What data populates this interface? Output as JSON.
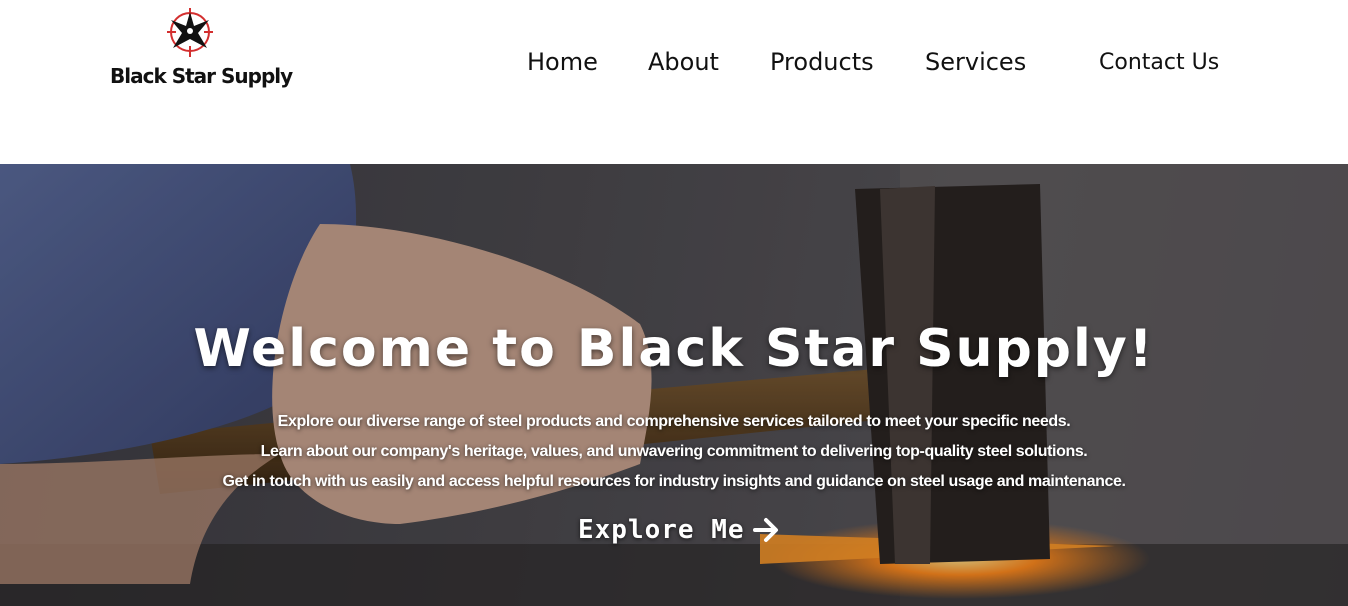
{
  "brand": {
    "name": "Black Star Supply",
    "logo_icon": "black-star-compass-icon"
  },
  "nav": {
    "items": [
      {
        "label": "Home"
      },
      {
        "label": "About"
      },
      {
        "label": "Products"
      },
      {
        "label": "Services"
      },
      {
        "label": "Contact Us"
      }
    ]
  },
  "hero": {
    "title": "Welcome to Black Star Supply!",
    "lines": [
      "Explore our diverse range of steel products and comprehensive services tailored to meet your specific needs.",
      "Learn about our company's heritage, values, and unwavering commitment to delivering top-quality steel solutions.",
      "Get in touch with us easily and access helpful resources for industry insights and guidance on steel usage and maintenance."
    ],
    "cta_label": "Explore Me",
    "cta_icon": "arrow-right-icon",
    "background": "blacksmith-hammer-photo"
  },
  "colors": {
    "text": "#111111",
    "logo_accent": "#d32f2f",
    "hero_text": "#ffffff",
    "ember": "#ff8a1e"
  }
}
